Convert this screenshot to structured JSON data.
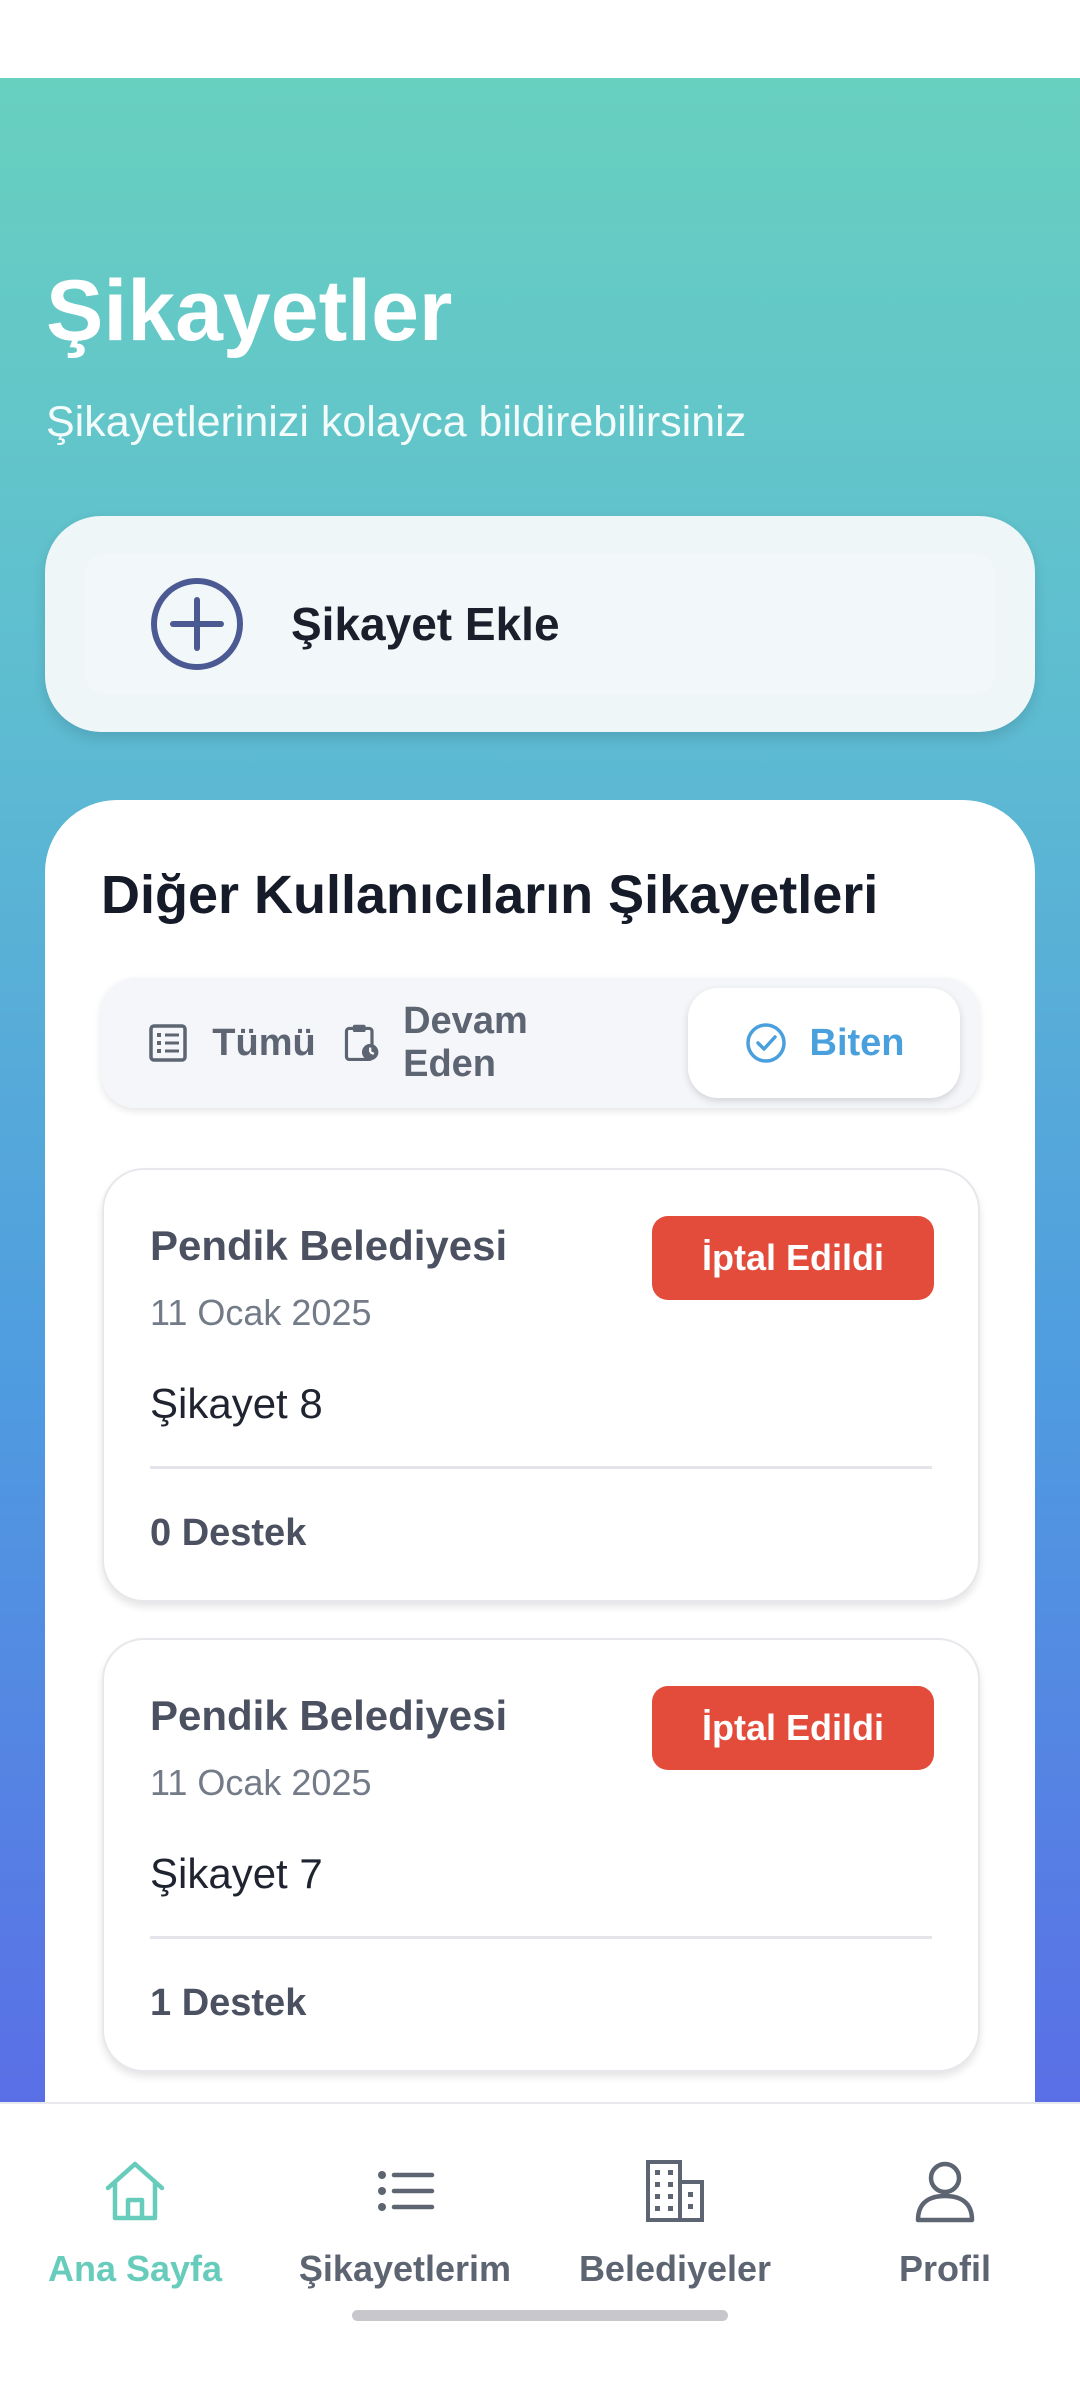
{
  "header": {
    "title": "Şikayetler",
    "subtitle": "Şikayetlerinizi kolayca bildirebilirsiniz"
  },
  "add_complaint": {
    "label": "Şikayet Ekle",
    "icon": "plus-circle-icon"
  },
  "section": {
    "title": "Diğer Kullanıcıların Şikayetleri"
  },
  "filter_tabs": [
    {
      "label": "Tümü",
      "icon": "list-icon",
      "active": false
    },
    {
      "label": "Devam Eden",
      "icon": "clipboard-clock-icon",
      "active": false
    },
    {
      "label": "Biten",
      "icon": "check-circle-icon",
      "active": true
    }
  ],
  "complaints": [
    {
      "municipality": "Pendik Belediyesi",
      "date": "11 Ocak 2025",
      "title": "Şikayet 8",
      "status": "İptal Edildi",
      "support": "0 Destek"
    },
    {
      "municipality": "Pendik Belediyesi",
      "date": "11 Ocak 2025",
      "title": "Şikayet 7",
      "status": "İptal Edildi",
      "support": "1 Destek"
    }
  ],
  "bottom_nav": [
    {
      "label": "Ana Sayfa",
      "icon": "home-icon",
      "active": true
    },
    {
      "label": "Şikayetlerim",
      "icon": "list-icon",
      "active": false
    },
    {
      "label": "Belediyeler",
      "icon": "building-icon",
      "active": false
    },
    {
      "label": "Profil",
      "icon": "user-icon",
      "active": false
    }
  ],
  "colors": {
    "accent_teal": "#67ccbb",
    "accent_blue": "#4aa0dc",
    "status_cancelled": "#e34b3b"
  }
}
